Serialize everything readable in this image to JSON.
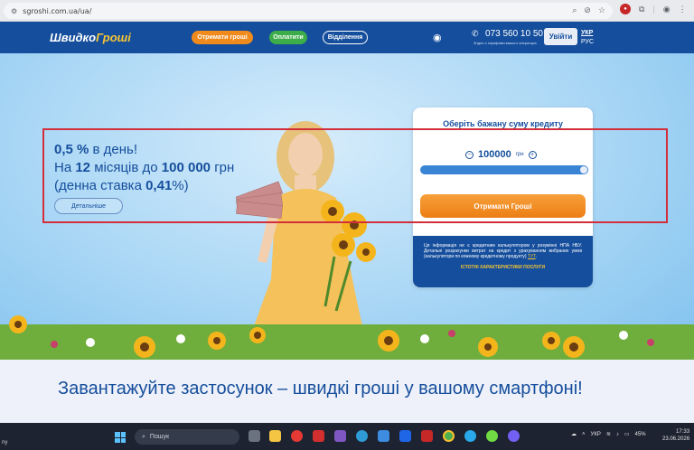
{
  "browser": {
    "url": "sgroshi.com.ua/ua/"
  },
  "header": {
    "logo_main": "Швидко",
    "logo_accent": "Гроші",
    "nav": [
      "Отримати гроші",
      "Оплатити",
      "Відділення"
    ],
    "phone": "073 560 10 50",
    "phone_note": "Згідно з тарифами вашого оператора",
    "login_label": "Увійти",
    "lang_active": "УКР",
    "lang_other": "РУС"
  },
  "offer": {
    "rate_value": "0,5 %",
    "rate_suffix": " в день!",
    "term_prefix": "На ",
    "term_months": "12",
    "term_mid": " місяців до ",
    "term_amount": "100 000",
    "term_suffix": " грн",
    "daily_prefix": "(денна ставка ",
    "daily_rate": "0,41",
    "daily_suffix": "%)",
    "details_label": "Детальніше"
  },
  "calculator": {
    "title": "Оберіть бажану суму кредиту",
    "amount": "100000",
    "currency": "грн",
    "slider_fraction": 1.0,
    "cta_label": "Отримати Гроші",
    "disclaimer": "Ця інформація не є кредитним калькулятором у розумінні НПА НБУ. Детальні розрахунки витрат на кредит з урахуванням вибраних умов (калькулятори по кожному кредитному продукту)",
    "disclaimer_link": "ТУТ",
    "essential_link": "ІСТОТНІ ХАРАКТЕРИСТИКИ ПОСЛУГИ"
  },
  "app_section": {
    "title": "Завантажуйте застосунок – швидкі гроші у вашому смартфоні!"
  },
  "taskbar": {
    "left_label": "ny",
    "search_placeholder": "Пошук",
    "lang": "УКР",
    "battery": "45%",
    "time": "17:33",
    "date": "23.06.2026"
  },
  "colors": {
    "brand_blue": "#154e9c",
    "accent_orange": "#f08a1c",
    "accent_green": "#3dad4a",
    "highlight_red": "#d32f3a"
  }
}
